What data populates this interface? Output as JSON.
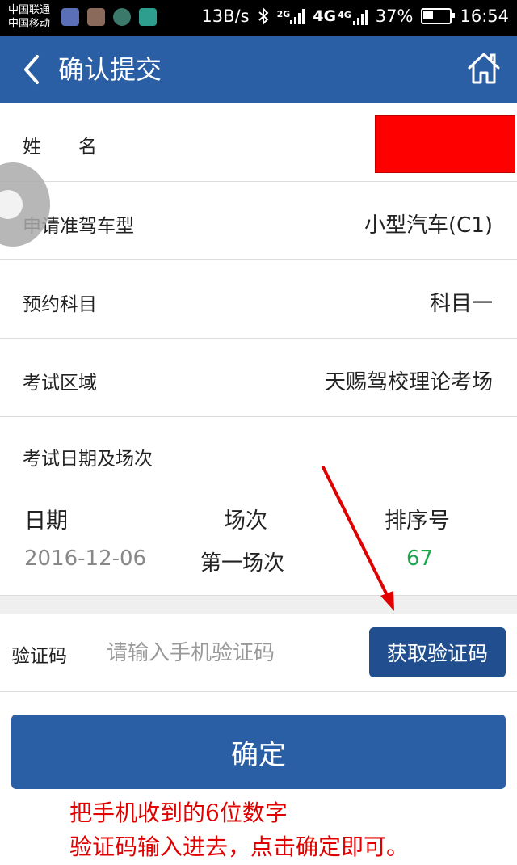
{
  "status_bar": {
    "carrier_1": "中国联通",
    "carrier_2": "中国移动",
    "speed": "13B/s",
    "net_2g": "2G",
    "net_4g_big": "4G",
    "net_4g_small": "4G",
    "battery": "37%",
    "time": "16:54"
  },
  "header": {
    "title": "确认提交"
  },
  "form": {
    "name_label": "姓　　名",
    "license_label": "申请准驾车型",
    "license_value": "小型汽车(C1)",
    "subject_label": "预约科目",
    "subject_value": "科目一",
    "area_label": "考试区域",
    "area_value": "天赐驾校理论考场",
    "schedule_label": "考试日期及场次",
    "columns": [
      "日期",
      "场次",
      "排序号"
    ],
    "date": "2016-12-06",
    "session": "第一场次",
    "order_no": "67"
  },
  "verify": {
    "label": "验证码",
    "placeholder": "请输入手机验证码",
    "get_code_label": "获取验证码"
  },
  "confirm_label": "确定",
  "annotation": {
    "line1": "把手机收到的6位数字",
    "line2": "验证码输入进去，点击确定即可。"
  },
  "colors": {
    "header_bg": "#2a5fa6",
    "button_bg": "#214e8e",
    "order_no_color": "#1aa64a",
    "annotation_color": "#e00000",
    "redaction": "#ff0000"
  },
  "icons": [
    "back-arrow-icon",
    "home-icon",
    "bluetooth-icon",
    "battery-icon",
    "signal-icon"
  ]
}
